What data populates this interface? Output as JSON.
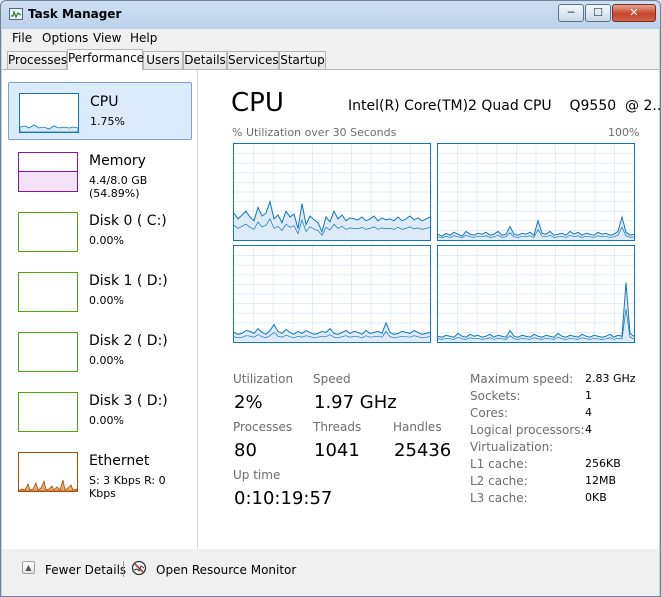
{
  "window": {
    "title": "Task Manager",
    "controls": {
      "minimize": "─",
      "maximize": "☐",
      "close": "✕"
    }
  },
  "menu": [
    "File",
    "Options",
    "View",
    "Help"
  ],
  "tabs": [
    "Processes",
    "Performance",
    "Users",
    "Details",
    "Services",
    "Startup"
  ],
  "active_tab": "Performance",
  "sidebar": [
    {
      "name": "CPU",
      "value": "1.75%",
      "color": "#1177bb"
    },
    {
      "name": "Memory",
      "value": "4.4/8.0 GB (54.89%)",
      "color": "#8b12ae"
    },
    {
      "name": "Disk 0 ( C:)",
      "value": "0.00%",
      "color": "#4da60c"
    },
    {
      "name": "Disk 1 ( D:)",
      "value": "0.00%",
      "color": "#4da60c"
    },
    {
      "name": "Disk 2 ( D:)",
      "value": "0.00%",
      "color": "#4da60c"
    },
    {
      "name": "Disk 3 ( D:)",
      "value": "0.00%",
      "color": "#4da60c"
    },
    {
      "name": "Ethernet",
      "value": "S: 3 Kbps R: 0 Kbps",
      "color": "#a74f01"
    }
  ],
  "main": {
    "title": "CPU",
    "cpu_name": "Intel(R) Core(TM)2 Quad CPU    Q9550  @ 2....",
    "graph_label": "% Utilization over 30 Seconds",
    "graph_max": "100%"
  },
  "stats": {
    "utilization": {
      "label": "Utilization",
      "value": "2%"
    },
    "speed": {
      "label": "Speed",
      "value": "1.97 GHz"
    },
    "processes": {
      "label": "Processes",
      "value": "80"
    },
    "threads": {
      "label": "Threads",
      "value": "1041"
    },
    "handles": {
      "label": "Handles",
      "value": "25436"
    },
    "uptime": {
      "label": "Up time",
      "value": "0:10:19:57"
    }
  },
  "specs": [
    {
      "label": "Maximum speed:",
      "value": "2.83 GHz"
    },
    {
      "label": "Sockets:",
      "value": "1"
    },
    {
      "label": "Cores:",
      "value": "4"
    },
    {
      "label": "Logical processors:",
      "value": "4"
    },
    {
      "label": "Virtualization:",
      "value": ""
    },
    {
      "label": "L1 cache:",
      "value": "256KB"
    },
    {
      "label": "L2 cache:",
      "value": "12MB"
    },
    {
      "label": "L3 cache:",
      "value": "0KB"
    }
  ],
  "footer": {
    "fewer_details": "Fewer Details",
    "resource_monitor": "Open Resource Monitor"
  },
  "colors": {
    "cpu_line": "#1177bb",
    "cpu_fill": "#d9eaf7",
    "grid": "#d9eaf7"
  }
}
